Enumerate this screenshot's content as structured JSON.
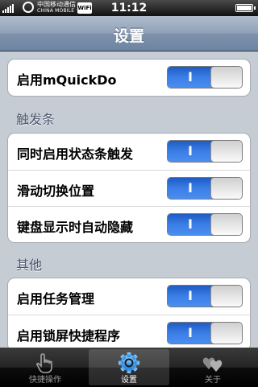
{
  "status_bar": {
    "carrier_cn": "中国移动通信",
    "carrier_en": "CHINA MOBILE",
    "wifi_label": "WiFi",
    "time": "11:12",
    "battery_level": 1.0
  },
  "nav": {
    "title": "设置"
  },
  "groups": {
    "main": {
      "items": [
        {
          "label": "启用mQuickDo",
          "toggle": "I",
          "on": true
        }
      ]
    },
    "trigger_bar": {
      "header": "触发条",
      "items": [
        {
          "label": "同时启用状态条触发",
          "toggle": "I",
          "on": true
        },
        {
          "label": "滑动切换位置",
          "toggle": "I",
          "on": true
        },
        {
          "label": "键盘显示时自动隐藏",
          "toggle": "I",
          "on": true
        }
      ]
    },
    "other": {
      "header": "其他",
      "items": [
        {
          "label": "启用任务管理",
          "toggle": "I",
          "on": true
        },
        {
          "label": "启用锁屏快捷程序",
          "toggle": "I",
          "on": true
        }
      ]
    }
  },
  "tabs": [
    {
      "label": "快捷操作",
      "icon": "hand-pointer-icon",
      "active": false
    },
    {
      "label": "设置",
      "icon": "gear-icon",
      "active": true
    },
    {
      "label": "关于",
      "icon": "hearts-icon",
      "active": false
    }
  ],
  "colors": {
    "toggle_on": "#3a7ee6",
    "nav_bar": "#8fa0b7",
    "background": "#c5ccd4",
    "section_header": "#4c566c",
    "tab_active": "#3b8fe8"
  }
}
